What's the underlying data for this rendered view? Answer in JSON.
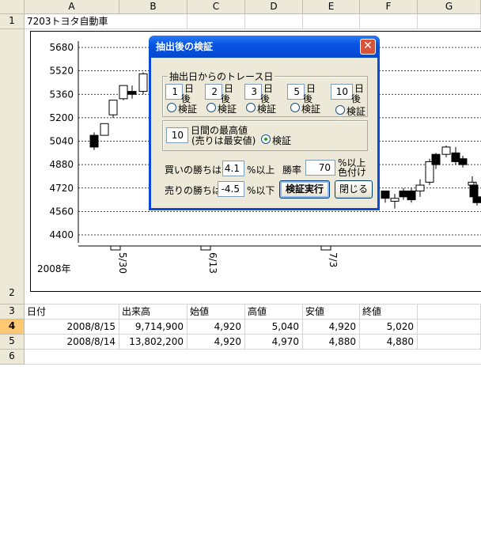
{
  "columns": [
    "A",
    "B",
    "C",
    "D",
    "E",
    "F",
    "G"
  ],
  "rows": [
    "1",
    "2",
    "3",
    "4",
    "5",
    "6"
  ],
  "title_cell": "7203トヨタ自動車",
  "chart": {
    "year_label": "2008年",
    "date_labels": [
      "5/30",
      "6/13",
      "7/3"
    ]
  },
  "chart_data": {
    "type": "candlestick",
    "y_ticks": [
      5680,
      5520,
      5360,
      5200,
      5040,
      4880,
      4720,
      4560,
      4400
    ],
    "ylim": [
      4400,
      5680
    ],
    "x_labels": [
      "5/30",
      "6/13",
      "7/3"
    ],
    "grid": true
  },
  "table": {
    "headers": [
      "日付",
      "出来高",
      "始値",
      "高値",
      "安値",
      "終値"
    ],
    "rows": [
      [
        "2008/8/15",
        "9,714,900",
        "4,920",
        "5,040",
        "4,920",
        "5,020"
      ],
      [
        "2008/8/14",
        "13,802,200",
        "4,920",
        "4,970",
        "4,880",
        "4,880"
      ]
    ]
  },
  "dialog": {
    "title": "抽出後の検証",
    "close_glyph": "✕",
    "trace_frame_label": "抽出日からのトレース日",
    "trace_days": [
      {
        "value": "1",
        "unit1": "日",
        "unit2": "後",
        "radio": "検証"
      },
      {
        "value": "2",
        "unit1": "日",
        "unit2": "後",
        "radio": "検証"
      },
      {
        "value": "3",
        "unit1": "日",
        "unit2": "後",
        "radio": "検証"
      },
      {
        "value": "5",
        "unit1": "日",
        "unit2": "後",
        "radio": "検証"
      },
      {
        "value": "10",
        "unit1": "日",
        "unit2": "後",
        "radio": "検証"
      }
    ],
    "max_days_value": "10",
    "max_label_1": "日間の最高値",
    "max_label_2": "(売りは最安値)",
    "max_radio": "検証",
    "buy_label": "買いの勝ちは",
    "buy_value": "4.1",
    "buy_unit": "%以上",
    "sell_label": "売りの勝ちは",
    "sell_value": "-4.5",
    "sell_unit": "%以下",
    "winrate_label": "勝率",
    "winrate_value": "70",
    "winrate_unit_1": "%以上",
    "winrate_unit_2": "色付け",
    "run_button": "検証実行",
    "close_button": "閉じる"
  }
}
